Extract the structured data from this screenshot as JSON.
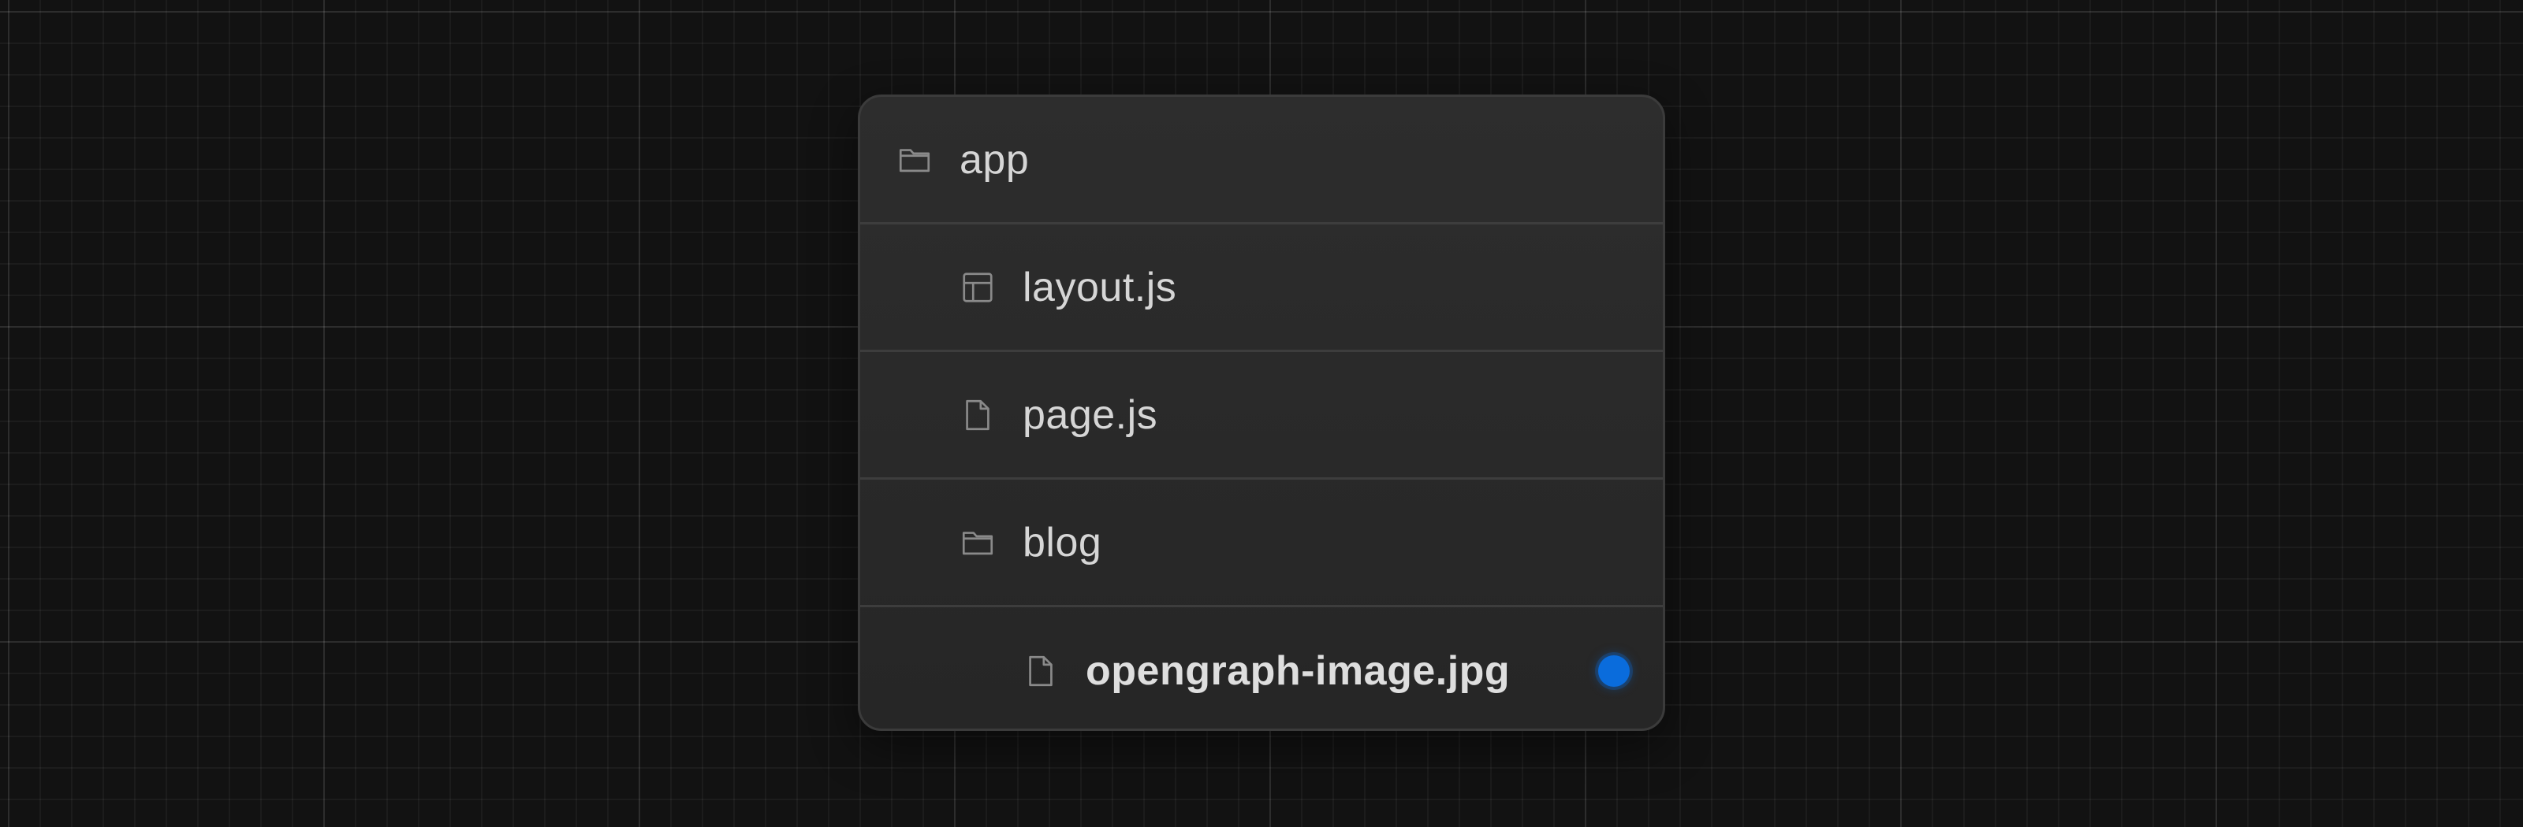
{
  "tree": {
    "items": [
      {
        "label": "app",
        "icon": "folder-icon",
        "depth": 0,
        "emphasized": false
      },
      {
        "label": "layout.js",
        "icon": "layout-icon",
        "depth": 1,
        "emphasized": false
      },
      {
        "label": "page.js",
        "icon": "file-icon",
        "depth": 1,
        "emphasized": false
      },
      {
        "label": "blog",
        "icon": "folder-icon",
        "depth": 1,
        "emphasized": false
      },
      {
        "label": "opengraph-image.jpg",
        "icon": "file-icon",
        "depth": 2,
        "emphasized": true,
        "indicator_color": "#0a6cdc"
      }
    ]
  },
  "colors": {
    "background": "#121212",
    "card": "#2a2a2a",
    "text": "#d6d6d6",
    "icon": "#8a8a8a",
    "accent": "#0a6cdc"
  }
}
